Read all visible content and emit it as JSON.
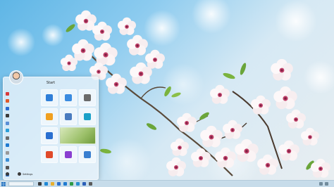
{
  "start_menu": {
    "title": "Start",
    "apps": [
      {
        "label": "",
        "color": "#d93a3a"
      },
      {
        "label": "",
        "color": "#e05a2a"
      },
      {
        "label": "",
        "color": "#2a6bd0"
      },
      {
        "label": "",
        "color": "#3a3a3a"
      },
      {
        "label": "",
        "color": "#5a8fd6"
      },
      {
        "label": "",
        "color": "#2b9fd8"
      },
      {
        "label": "",
        "color": "#6a6a6a"
      },
      {
        "label": "",
        "color": "#1f7ad0"
      },
      {
        "label": "",
        "color": "#999999"
      },
      {
        "label": "",
        "color": "#3b8fd6"
      },
      {
        "label": "",
        "color": "#555555"
      },
      {
        "label": "",
        "color": "#2f73c9"
      }
    ],
    "tiles": [
      {
        "label": "",
        "color": "#2f7fd8"
      },
      {
        "label": "",
        "color": "#3a8be0"
      },
      {
        "label": "",
        "color": "#6a6a6a"
      },
      {
        "label": "",
        "color": "#f0a020"
      },
      {
        "label": "",
        "color": "#4a7bbf"
      },
      {
        "label": "",
        "color": "#1aa0c8"
      },
      {
        "label": "",
        "color": "#2a6fd0"
      },
      {
        "label": "",
        "color": "#8fae4a"
      },
      {
        "label": "",
        "color": "#e04a2a"
      },
      {
        "label": "",
        "color": "#8a3fd0"
      },
      {
        "label": "",
        "color": "#3a7fd0"
      }
    ],
    "bottom": {
      "power_label": "",
      "settings_label": "Settings"
    }
  },
  "taskbar": {
    "search_placeholder": "",
    "pinned": [
      {
        "name": "task-view-icon",
        "color": "#3a3a3a"
      },
      {
        "name": "edge-icon",
        "color": "#1e88d6"
      },
      {
        "name": "file-explorer-icon",
        "color": "#e8b030"
      },
      {
        "name": "store-icon",
        "color": "#2a6fd0"
      },
      {
        "name": "mail-icon",
        "color": "#1f7ad0"
      },
      {
        "name": "chrome-icon",
        "color": "#2f9a46"
      },
      {
        "name": "photos-icon",
        "color": "#2a8fd0"
      },
      {
        "name": "word-icon",
        "color": "#2b5fb8"
      },
      {
        "name": "settings-icon",
        "color": "#5a5a5a"
      }
    ],
    "clock": {
      "time": "",
      "date": ""
    }
  }
}
